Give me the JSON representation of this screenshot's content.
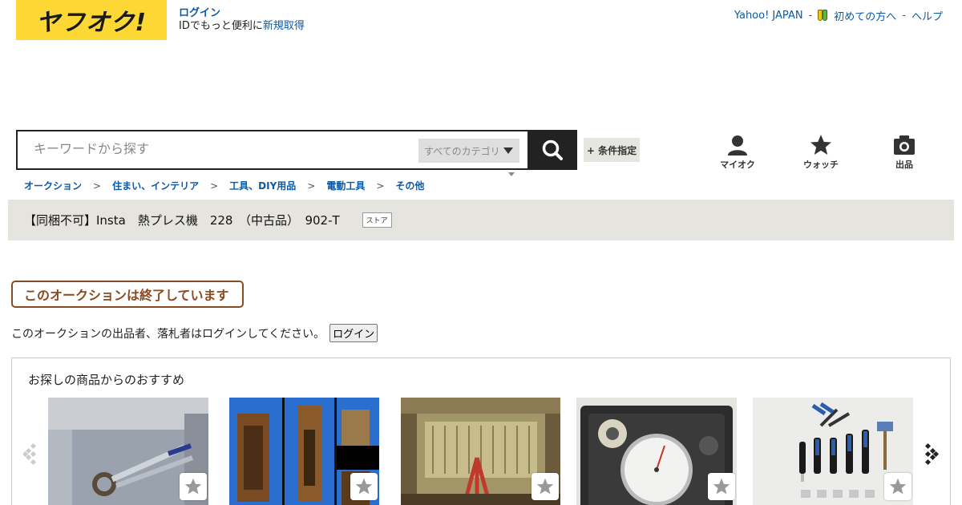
{
  "header": {
    "logo_text": "ヤフオク!",
    "login_label": "ログイン",
    "login_sub": "IDでもっと便利に",
    "signup_label": "新規取得",
    "yahoo_japan": "Yahoo! JAPAN",
    "first_time": "初めての方へ",
    "help": "ヘルプ"
  },
  "search": {
    "placeholder": "キーワードから探す",
    "category_label": "すべてのカテゴリ",
    "condition_label": "+ 条件指定"
  },
  "nav": {
    "myauc": "マイオク",
    "watch": "ウォッチ",
    "sell": "出品"
  },
  "breadcrumb": [
    "オークション",
    "住まい、インテリア",
    "工具、DIY用品",
    "電動工具",
    "その他"
  ],
  "breadcrumb_sep": ">",
  "item": {
    "title": "【同梱不可】Insta　熱プレス機　228　（中古品）　902-T",
    "store_badge": "ストア"
  },
  "status": {
    "ended_text": "このオークションは終了しています",
    "login_message": "このオークションの出品者、落札者はログインしてください。",
    "login_button": "ログイン"
  },
  "recommend": {
    "title": "お探しの商品からのおすすめ"
  },
  "colors": {
    "brand_yellow": "#fdd835",
    "link_blue": "#0b5aa8",
    "ended_brown": "#8b4a1f"
  }
}
